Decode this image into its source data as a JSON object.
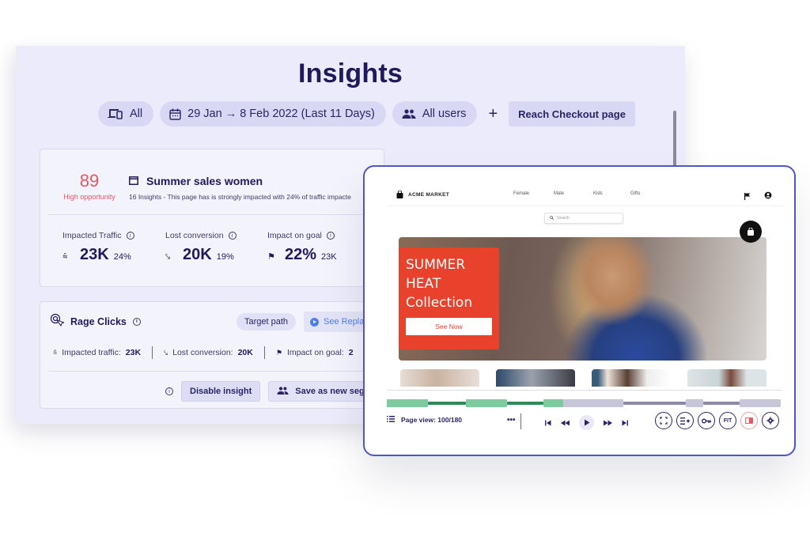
{
  "insights": {
    "title": "Insights",
    "filters": {
      "device": "All",
      "date_range": "29 Jan → 8 Feb 2022 (Last 11 Days)",
      "segment": "All users",
      "add": "+",
      "goal": "Reach Checkout page"
    },
    "page_card": {
      "score": "89",
      "score_label": "High opportunity",
      "title": "Summer sales women",
      "description": "16 Insights -  This page has is strongly impacted with 24% of traffic impacte",
      "metrics": [
        {
          "label": "Impacted Traffic",
          "icon": "trending-icon",
          "value": "23K",
          "sub": "24%"
        },
        {
          "label": "Lost conversion",
          "icon": "trending-down-icon",
          "value": "20K",
          "sub": "19%"
        },
        {
          "label": "Impact on goal",
          "icon": "flag-icon",
          "value": "22%",
          "sub": "23K"
        }
      ]
    },
    "rage_card": {
      "title": "Rage Clicks",
      "target_path": "Target path",
      "see_replay": "See Replay",
      "stats": [
        {
          "label": "Impacted traffic:",
          "value": "23K"
        },
        {
          "label": "Lost conversion:",
          "value": "20K"
        },
        {
          "label": "Impact on goal:",
          "value": "2"
        }
      ],
      "disable": "Disable insight",
      "save_segment": "Save as new segment"
    }
  },
  "replay": {
    "site": {
      "brand": "ACME MARKET",
      "nav": [
        "Female",
        "Male",
        "Kids",
        "Gifts"
      ],
      "search_placeholder": "Search",
      "hero_lines": [
        "SUMMER",
        "HEAT",
        "Collection"
      ],
      "hero_cta": "See Now"
    },
    "timeline": {
      "progress": 0.45,
      "segments": [
        {
          "from": 0.0,
          "to": 0.105,
          "kind": "page",
          "state": "played"
        },
        {
          "from": 0.105,
          "to": 0.2,
          "kind": "gap",
          "state": "played"
        },
        {
          "from": 0.2,
          "to": 0.305,
          "kind": "page",
          "state": "played"
        },
        {
          "from": 0.305,
          "to": 0.397,
          "kind": "gap",
          "state": "played"
        },
        {
          "from": 0.397,
          "to": 0.447,
          "kind": "page",
          "state": "played"
        },
        {
          "from": 0.447,
          "to": 0.6,
          "kind": "page",
          "state": "remaining"
        },
        {
          "from": 0.6,
          "to": 0.76,
          "kind": "gap",
          "state": "remaining"
        },
        {
          "from": 0.76,
          "to": 0.804,
          "kind": "page",
          "state": "remaining"
        },
        {
          "from": 0.804,
          "to": 0.895,
          "kind": "gap",
          "state": "remaining"
        },
        {
          "from": 0.895,
          "to": 1.0,
          "kind": "page",
          "state": "remaining"
        }
      ],
      "colors": {
        "played_page": "#7fcba0",
        "played_gap": "#2f8a5a",
        "remaining_page": "#c7c6d9",
        "remaining_gap": "#8c8aa8"
      }
    },
    "page_view": "Page view: 100/180",
    "more": "•••",
    "transport": [
      "skip-start",
      "rewind",
      "play",
      "fast-forward",
      "skip-end"
    ],
    "tools": [
      "fullscreen-icon",
      "add-list-icon",
      "key-icon",
      "FIT",
      "record-icon",
      "settings-icon"
    ],
    "fit_label": "FIT"
  }
}
